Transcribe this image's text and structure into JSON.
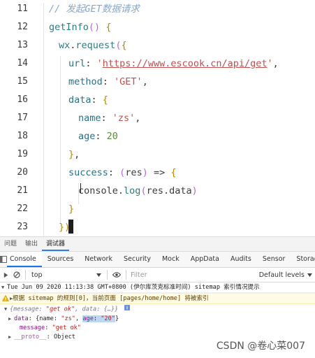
{
  "editor": {
    "line_numbers": [
      "11",
      "12",
      "13",
      "14",
      "15",
      "16",
      "17",
      "18",
      "19",
      "20",
      "21",
      "22",
      "23"
    ],
    "lines": {
      "l11": {
        "comment": "// 发起GET数据请求"
      },
      "l12": {
        "fn": "getInfo",
        "paren": "()",
        "brace": "{"
      },
      "l13": {
        "obj": "wx",
        "dot": ".",
        "fn": "request",
        "paren": "(",
        "brace": "{"
      },
      "l14": {
        "key": "url",
        "colon": ": ",
        "q1": "'",
        "url": "https://www.escook.cn/api/get",
        "q2": "'",
        "comma": ","
      },
      "l15": {
        "key": "method",
        "colon": ": ",
        "str": "'GET'",
        "comma": ","
      },
      "l16": {
        "key": "data",
        "colon": ": ",
        "brace": "{"
      },
      "l17": {
        "key": "name",
        "colon": ": ",
        "str": "'zs'",
        "comma": ","
      },
      "l18": {
        "key": "age",
        "colon": ": ",
        "num": "20"
      },
      "l19": {
        "brace": "}",
        "comma": ","
      },
      "l20": {
        "key": "success",
        "colon": ": ",
        "p1": "(",
        "arg": "res",
        "p2": ")",
        "arrow": " => ",
        "brace": "{"
      },
      "l21": {
        "obj": "console",
        "dot": ".",
        "fn": "log",
        "p1": "(",
        "arg": "res.data",
        "p2": ")"
      },
      "l22": {
        "brace": "}"
      },
      "l23": {
        "brace": "})"
      }
    }
  },
  "panel_tabs": [
    "问题",
    "输出",
    "调试器"
  ],
  "devtools_tabs": [
    "Console",
    "Sources",
    "Network",
    "Security",
    "Mock",
    "AppData",
    "Audits",
    "Sensor",
    "Storage"
  ],
  "toolbar": {
    "context": "top",
    "filter_placeholder": "Filter",
    "levels": "Default levels"
  },
  "console": {
    "log_time": "Tue Jun 09 2020 11:13:38 GMT+0800 (伊尔库茨克标准时间) sitemap 索引情况提示",
    "warning": "根据 sitemap 的规则[0]，当前页面 [pages/home/home] 将被索引",
    "obj_summary": {
      "open": "{",
      "k1": "message",
      "v1": "\"get ok\"",
      "sep": ", ",
      "k2": "data",
      "v2": "{…}",
      "close": "}"
    },
    "data_line": {
      "key": "data",
      "pre": "{name: ",
      "name_val": "\"zs\"",
      "mid": ", ",
      "age_key": "age",
      "age_val": "\"20\"",
      "end": "}"
    },
    "message_line": {
      "key": "message",
      "val": "\"get ok\""
    },
    "proto_line": {
      "key": "__proto__",
      "val": "Object"
    }
  },
  "watermark": "CSDN @卷心菜007",
  "colors": {
    "accent": "#1a73e8",
    "warning_bg": "#fffbe5"
  }
}
